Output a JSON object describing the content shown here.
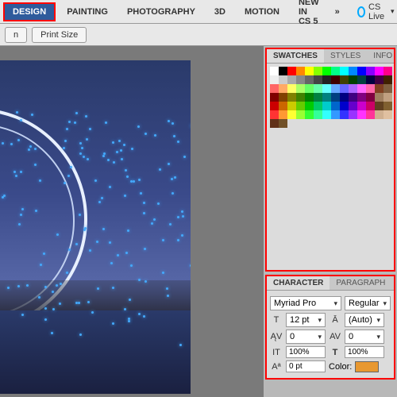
{
  "topbar": {
    "tabs": [
      "DESIGN",
      "PAINTING",
      "PHOTOGRAPHY",
      "3D",
      "MOTION",
      "NEW IN CS 5"
    ],
    "activeTab": "DESIGN",
    "more": "»",
    "cslive": "CS Live",
    "cslive_arrow": "▾"
  },
  "toolbar2": {
    "btnA": "n",
    "btnB": "Print Size"
  },
  "swatches": {
    "tabs": [
      "SWATCHES",
      "STYLES",
      "INFO"
    ],
    "activeTab": "SWATCHES",
    "colors": [
      "#ffffff",
      "#000000",
      "#ff0000",
      "#ff8800",
      "#ffff00",
      "#88ff00",
      "#00ff00",
      "#00ff88",
      "#00ffff",
      "#0088ff",
      "#0000ff",
      "#8800ff",
      "#ff00ff",
      "#ff0088",
      "#eeeeee",
      "#cccccc",
      "#aaaaaa",
      "#888888",
      "#666666",
      "#444444",
      "#222222",
      "#400000",
      "#404000",
      "#004000",
      "#004040",
      "#000040",
      "#400040",
      "#402000",
      "#ff6666",
      "#ffaa66",
      "#ffff66",
      "#aaff66",
      "#66ff66",
      "#66ffaa",
      "#66ffff",
      "#66aaff",
      "#6666ff",
      "#aa66ff",
      "#ff66ff",
      "#ff66aa",
      "#804020",
      "#806040",
      "#800000",
      "#804000",
      "#808000",
      "#408000",
      "#008000",
      "#008040",
      "#008080",
      "#004080",
      "#000080",
      "#400080",
      "#800080",
      "#800040",
      "#a08060",
      "#c0a080",
      "#cc0000",
      "#cc6600",
      "#cccc00",
      "#66cc00",
      "#00cc00",
      "#00cc66",
      "#00cccc",
      "#0066cc",
      "#0000cc",
      "#6600cc",
      "#cc00cc",
      "#cc0066",
      "#604020",
      "#806030",
      "#ff3333",
      "#ff9933",
      "#ffff33",
      "#99ff33",
      "#33ff33",
      "#33ff99",
      "#33ffff",
      "#3399ff",
      "#3333ff",
      "#9933ff",
      "#ff33ff",
      "#ff3399",
      "#d0b090",
      "#e0c0a0",
      "#603018",
      "#705028"
    ]
  },
  "character": {
    "tabs": [
      "CHARACTER",
      "PARAGRAPH"
    ],
    "activeTab": "CHARACTER",
    "font": "Myriad Pro",
    "style": "Regular",
    "size": "12 pt",
    "leading": "(Auto)",
    "kerning": "0",
    "tracking": "0",
    "vscale": "100%",
    "hscale": "100%",
    "baseline": "0 pt",
    "color_label": "Color:",
    "color": "#e89830",
    "arrow": "▾"
  }
}
